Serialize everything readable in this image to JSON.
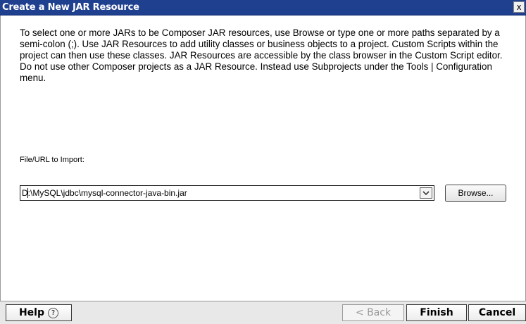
{
  "window": {
    "title": "Create a New JAR Resource",
    "close_label": "x"
  },
  "description": "To select one or more JARs to be Composer JAR  resources, use Browse or type one or more paths separated by a semi-colon (;). Use JAR Resources to add utility classes or business objects to a project. Custom Scripts within the project can then use these classes.  JAR Resources are accessible by the class browser in the Custom Script editor. Do not use other Composer projects as a JAR Resource.  Instead use Subprojects under the Tools | Configuration menu.",
  "import_field": {
    "label": "File/URL to Import:",
    "value": "D:\\MySQL\\jdbc\\mysql-connector-java-bin.jar"
  },
  "buttons": {
    "browse": "Browse...",
    "help": "Help",
    "help_glyph": "?",
    "back": "< Back",
    "finish": "Finish",
    "cancel": "Cancel"
  }
}
